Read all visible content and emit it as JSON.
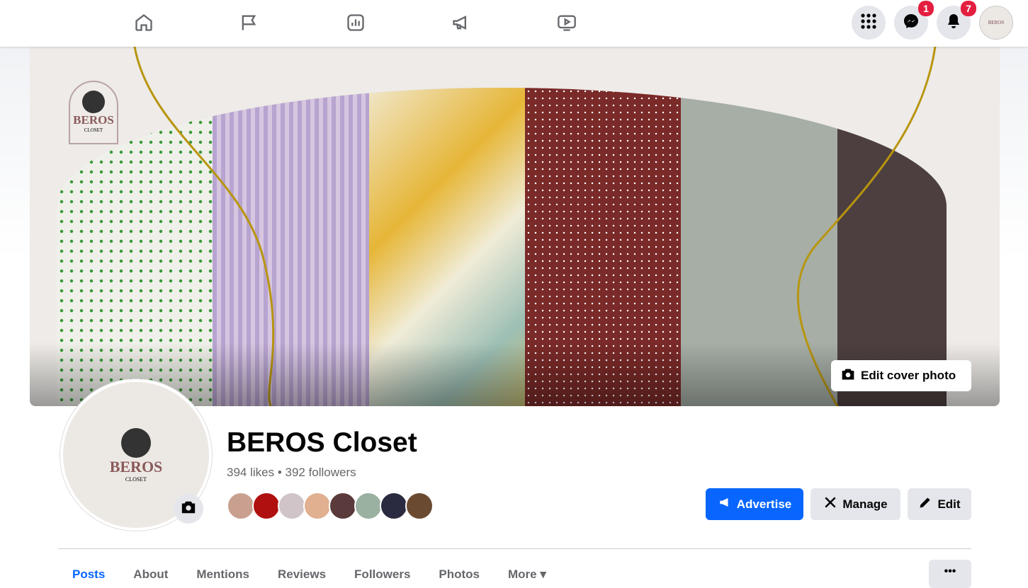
{
  "topnav": {
    "icons": [
      "home-icon",
      "flag-icon",
      "insights-icon",
      "megaphone-icon",
      "video-icon"
    ],
    "menu_icon": "grid-icon",
    "messenger_badge": "1",
    "notifications_badge": "7"
  },
  "cover": {
    "edit_label": "Edit cover photo",
    "logo_text": "BEROS",
    "logo_sub": "CLOSET"
  },
  "profile": {
    "name": "BEROS Closet",
    "stats": "394 likes • 392 followers",
    "logo_text": "BEROS",
    "logo_sub": "CLOSET"
  },
  "actions": {
    "advertise": "Advertise",
    "manage": "Manage",
    "edit": "Edit"
  },
  "tabs": [
    "Posts",
    "About",
    "Mentions",
    "Reviews",
    "Followers",
    "Photos",
    "More ▾"
  ],
  "more_button": "•••",
  "colors": {
    "accent": "#0866ff",
    "badge": "#e41e3f"
  }
}
